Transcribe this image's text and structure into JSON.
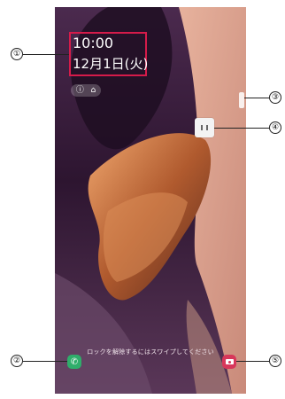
{
  "lockscreen": {
    "time": "10:00",
    "date": "12月1日(火)",
    "info_icon": "ⓘ",
    "home_icon": "⌂",
    "swipe_hint": "ロックを解除するにはスワイプしてください",
    "phone_icon_glyph": "✆"
  },
  "callouts": [
    "①",
    "②",
    "③",
    "④",
    "⑤"
  ],
  "colors": {
    "highlight_box": "#d51b4a",
    "phone_button": "#2fae6b",
    "camera_button": "#d7375a"
  }
}
